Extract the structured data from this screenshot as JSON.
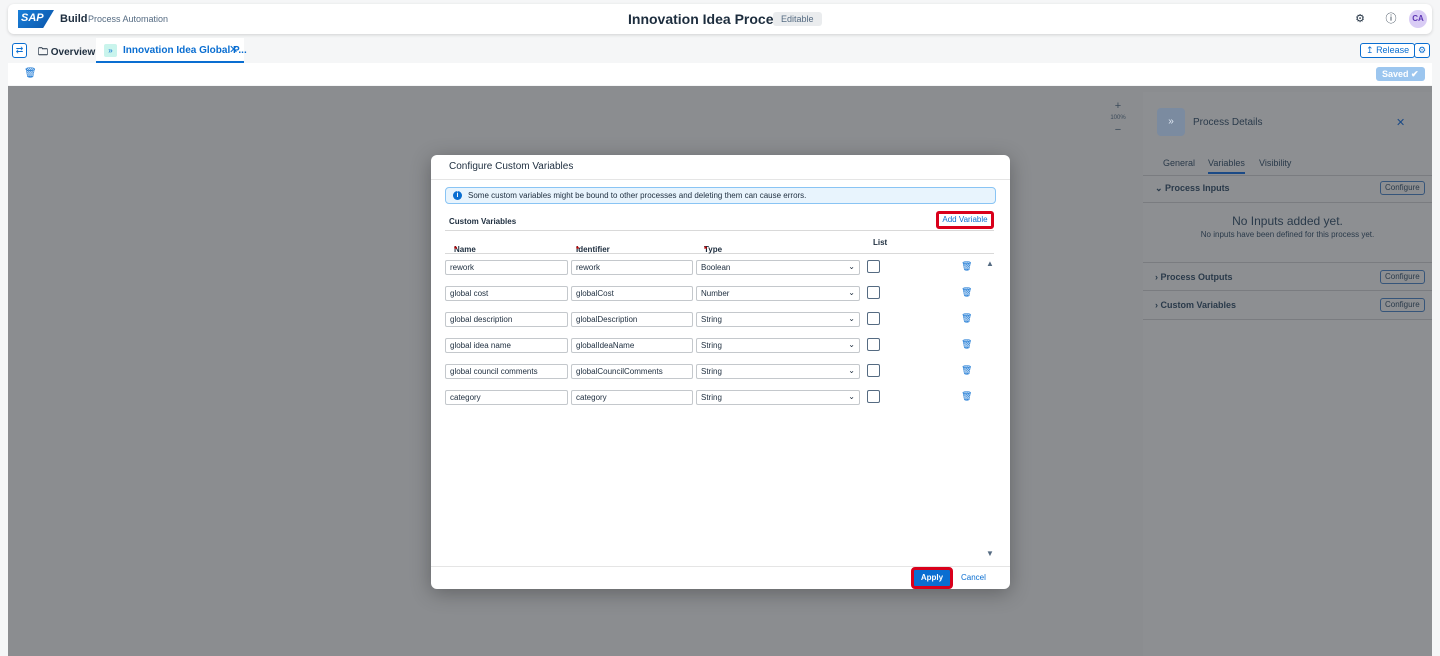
{
  "shell": {
    "logo": "SAP",
    "build": "Build",
    "product": "Process Automation",
    "title": "Innovation Idea Process",
    "badge": "Editable",
    "avatar": "CA"
  },
  "tabs": {
    "overview": "Overview",
    "active": "Innovation Idea Global P...",
    "release": "Release"
  },
  "toolbar": {
    "saved": "Saved"
  },
  "zoom": {
    "plus": "+",
    "level": "100%",
    "minus": "−"
  },
  "panel": {
    "title": "Process Details",
    "tabs": [
      "General",
      "Variables",
      "Visibility"
    ],
    "sections": [
      {
        "label": "Process Inputs",
        "action": "Configure"
      },
      {
        "label": "Process Outputs",
        "action": "Configure"
      },
      {
        "label": "Custom Variables",
        "action": "Configure"
      }
    ],
    "empty_title": "No Inputs added yet.",
    "empty_sub": "No inputs have been defined for this process yet."
  },
  "dialog": {
    "title": "Configure Custom Variables",
    "info": "Some custom variables might be bound to other processes and deleting them can cause errors.",
    "section_title": "Custom Variables",
    "add_variable": "Add Variable",
    "columns": {
      "name": "Name",
      "identifier": "Identifier",
      "type": "Type",
      "list": "List",
      "required": "*"
    },
    "rows": [
      {
        "name": "rework",
        "identifier": "rework",
        "type": "Boolean"
      },
      {
        "name": "global cost",
        "identifier": "globalCost",
        "type": "Number"
      },
      {
        "name": "global description",
        "identifier": "globalDescription",
        "type": "String"
      },
      {
        "name": "global idea name",
        "identifier": "globalIdeaName",
        "type": "String"
      },
      {
        "name": "global council comments",
        "identifier": "globalCouncilComments",
        "type": "String"
      },
      {
        "name": "category",
        "identifier": "category",
        "type": "String"
      }
    ],
    "apply": "Apply",
    "cancel": "Cancel"
  }
}
